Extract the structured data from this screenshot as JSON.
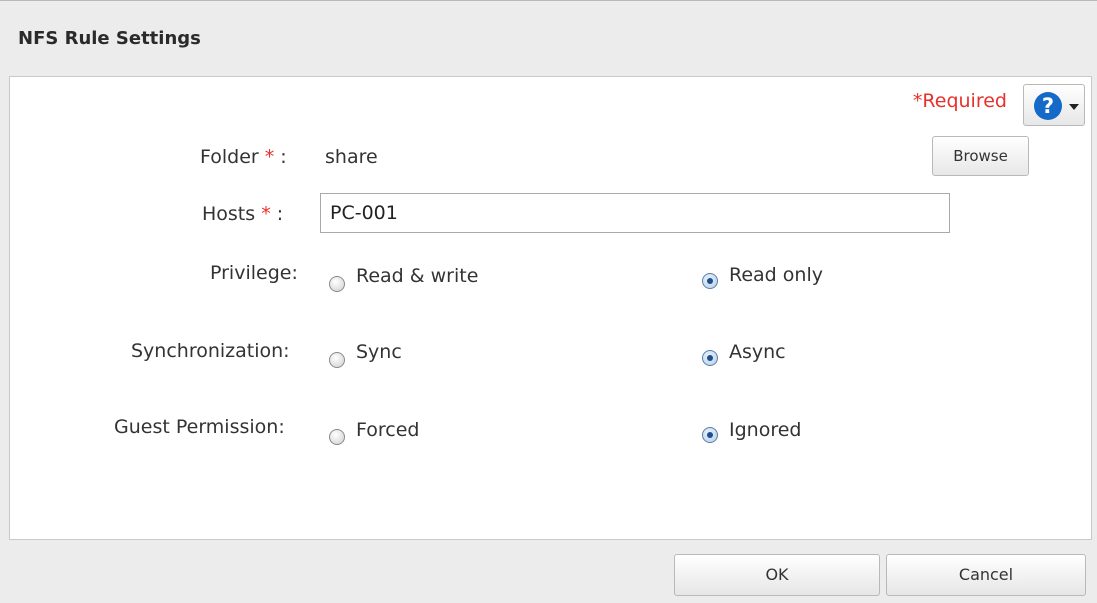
{
  "dialog": {
    "title": "NFS Rule Settings"
  },
  "required_label": "*Required",
  "help": {
    "icon_glyph": "?",
    "icon": "help-icon",
    "dropdown_icon": "chevron-down-icon"
  },
  "folder": {
    "label": "Folder",
    "star": "*",
    "separator": " :",
    "value": "share",
    "browse_label": "Browse"
  },
  "hosts": {
    "label": "Hosts",
    "star": "*",
    "separator": " :",
    "value": "PC-001"
  },
  "privilege": {
    "label": "Privilege:",
    "options": [
      {
        "label": "Read & write",
        "checked": false
      },
      {
        "label": "Read only",
        "checked": true
      }
    ]
  },
  "synchronization": {
    "label": "Synchronization:",
    "options": [
      {
        "label": "Sync",
        "checked": false
      },
      {
        "label": "Async",
        "checked": true
      }
    ]
  },
  "guest_permission": {
    "label": "Guest Permission:",
    "options": [
      {
        "label": "Forced",
        "checked": false
      },
      {
        "label": "Ignored",
        "checked": true
      }
    ]
  },
  "footer": {
    "ok_label": "OK",
    "cancel_label": "Cancel"
  },
  "colors": {
    "required": "#e8302c",
    "help_icon": "#1569c7",
    "radio_selected": "#1b4f8d"
  }
}
